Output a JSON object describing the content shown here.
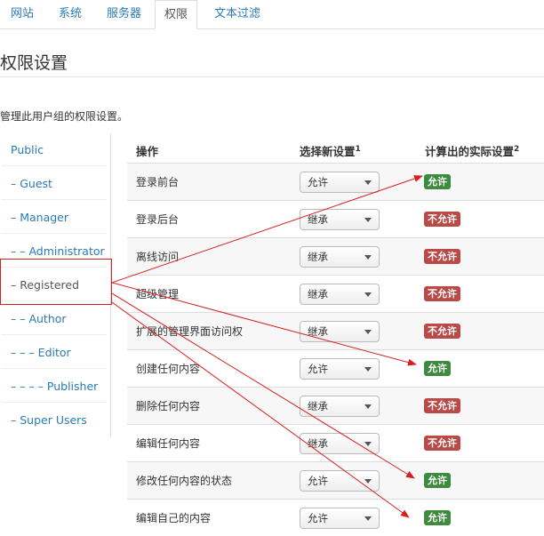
{
  "tabs": [
    "网站",
    "系统",
    "服务器",
    "权限",
    "文本过滤"
  ],
  "active_tab": "权限",
  "page_title": "权限设置",
  "description": "管理此用户组的权限设置。",
  "groups": [
    "Public",
    "– Guest",
    "– Manager",
    "– – Administrator",
    "– Registered",
    "– – Author",
    "– – – Editor",
    "– – – – Publisher",
    "– Super Users"
  ],
  "selected_group": "– Registered",
  "table": {
    "headers": {
      "action": "操作",
      "new_setting": "选择新设置",
      "new_setting_note": "1",
      "computed": "计算出的实际设置",
      "computed_note": "2"
    },
    "rows": [
      {
        "action": "登录前台",
        "setting": "允许",
        "computed": "允许",
        "status": "allow"
      },
      {
        "action": "登录后台",
        "setting": "继承",
        "computed": "不允许",
        "status": "deny"
      },
      {
        "action": "离线访问",
        "setting": "继承",
        "computed": "不允许",
        "status": "deny"
      },
      {
        "action": "超级管理",
        "setting": "继承",
        "computed": "不允许",
        "status": "deny"
      },
      {
        "action": "扩展的管理界面访问权",
        "setting": "继承",
        "computed": "不允许",
        "status": "deny"
      },
      {
        "action": "创建任何内容",
        "setting": "允许",
        "computed": "允许",
        "status": "allow"
      },
      {
        "action": "删除任何内容",
        "setting": "继承",
        "computed": "不允许",
        "status": "deny"
      },
      {
        "action": "编辑任何内容",
        "setting": "继承",
        "computed": "不允许",
        "status": "deny"
      },
      {
        "action": "修改任何内容的状态",
        "setting": "允许",
        "computed": "允许",
        "status": "allow"
      },
      {
        "action": "编辑自己的内容",
        "setting": "允许",
        "computed": "允许",
        "status": "allow"
      }
    ]
  },
  "colors": {
    "link": "#2a7ab5",
    "allow": "#3d8b3d",
    "deny": "#b94a48",
    "annotation": "#d62020"
  },
  "icons": {
    "select_caret": "chevron-down-icon"
  }
}
